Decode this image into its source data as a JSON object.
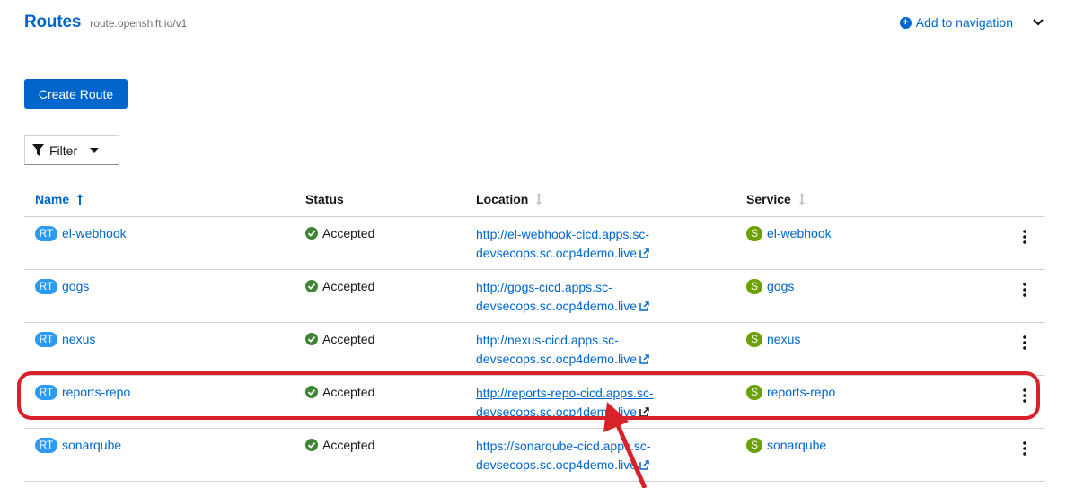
{
  "header": {
    "title": "Routes",
    "api_version": "route.openshift.io/v1",
    "add_to_nav": "Add to navigation"
  },
  "toolbar": {
    "create_label": "Create Route",
    "filter_label": "Filter"
  },
  "table": {
    "columns": {
      "name": "Name",
      "status": "Status",
      "location": "Location",
      "service": "Service"
    },
    "rows": [
      {
        "badge": "RT",
        "name": "el-webhook",
        "status": "Accepted",
        "location_line1": "http://el-webhook-cicd.apps.sc-",
        "location_line2": "devsecops.sc.ocp4demo.live",
        "service_badge": "S",
        "service": "el-webhook"
      },
      {
        "badge": "RT",
        "name": "gogs",
        "status": "Accepted",
        "location_line1": "http://gogs-cicd.apps.sc-",
        "location_line2": "devsecops.sc.ocp4demo.live",
        "service_badge": "S",
        "service": "gogs"
      },
      {
        "badge": "RT",
        "name": "nexus",
        "status": "Accepted",
        "location_line1": "http://nexus-cicd.apps.sc-",
        "location_line2": "devsecops.sc.ocp4demo.live",
        "service_badge": "S",
        "service": "nexus"
      },
      {
        "badge": "RT",
        "name": "reports-repo",
        "status": "Accepted",
        "location_line1": "http://reports-repo-cicd.apps.sc-",
        "location_line2": "devsecops.sc.ocp4demo.live",
        "service_badge": "S",
        "service": "reports-repo"
      },
      {
        "badge": "RT",
        "name": "sonarqube",
        "status": "Accepted",
        "location_line1": "https://sonarqube-cicd.apps.sc-",
        "location_line2": "devsecops.sc.ocp4demo.live",
        "service_badge": "S",
        "service": "sonarqube"
      }
    ]
  },
  "colors": {
    "link": "#0066cc",
    "route_badge": "#2b9af3",
    "service_badge": "#6ca100",
    "status_ok": "#3e8635",
    "highlight": "#d9212a"
  },
  "icons": {
    "add": "plus-circle-icon",
    "expand": "chevron-down-icon",
    "filter": "filter-icon",
    "sort": "sort-icon",
    "status": "check-circle-icon",
    "external": "external-link-icon",
    "actions": "kebab-icon"
  }
}
